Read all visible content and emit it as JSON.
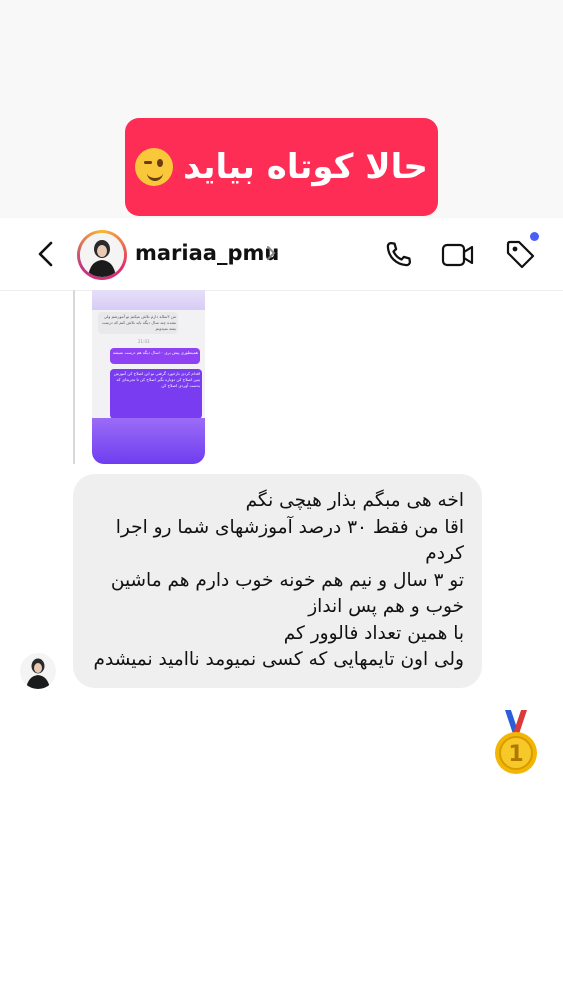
{
  "banner": {
    "title": "حالا کوتاه بیاید",
    "emoji": "winking-face-emoji"
  },
  "header": {
    "username": "mariaa_pmu",
    "icons": [
      "back-icon",
      "phone-icon",
      "video-icon",
      "tag-icon"
    ],
    "notification_dot_color": "#4a5ff7"
  },
  "reply_preview": {
    "grey_bubble": "من ۳ساله دارم تلاش میکنم تو آموزشم ولی نشده چند سال دیگه باید تلاش کنم که درست بشه نمیدونم",
    "time": "21:03",
    "purple_1": "همینطوری پیش بری ۱۰سال دیگه هم درست نمیشه",
    "purple_2": "اقدام کردی بازخورد گرفتی تو این اصلاح کن آموزش ببین اصلاح کن دوباره بگیر اصلاح کن تا تجربه‌ای که بدست آوردی اصلاح کن"
  },
  "message": {
    "text": "اخه هی مبگم بذار هیچی نگم\nاقا من فقط ۳۰ درصد آموزشهای شما رو اجرا کردم\nتو ۳ سال و نیم هم خونه خوب دارم هم ماشین خوب و هم پس انداز\nبا همین تعداد فالوور کم\nولی اون تایمهایی که کسی نمیومد ناامید نمیشدم"
  },
  "reaction": {
    "icon": "gold-medal-icon",
    "label": "1"
  },
  "colors": {
    "banner_bg": "#fd2d55",
    "bubble_bg": "#efefef"
  }
}
